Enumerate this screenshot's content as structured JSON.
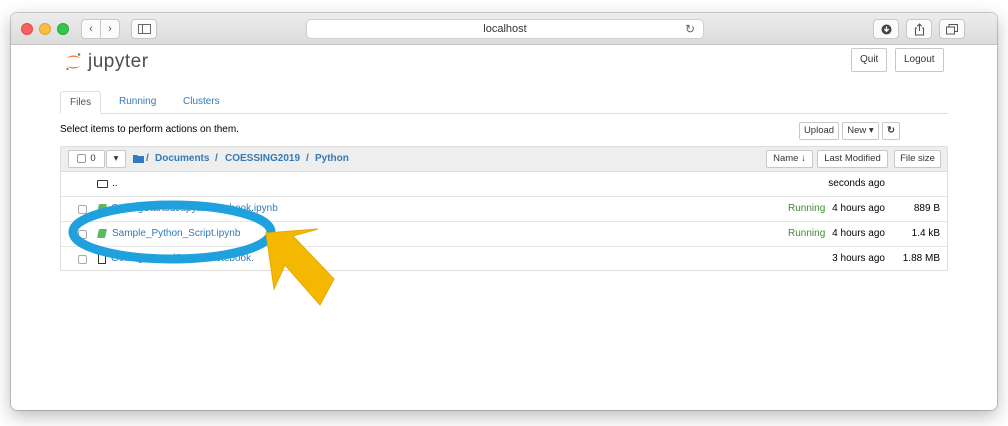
{
  "browser": {
    "url": "localhost",
    "nav_back": "‹",
    "nav_forward": "›"
  },
  "header": {
    "logo_text": "jupyter",
    "quit_label": "Quit",
    "logout_label": "Logout"
  },
  "tabs": [
    {
      "label": "Files",
      "active": true
    },
    {
      "label": "Running",
      "active": false
    },
    {
      "label": "Clusters",
      "active": false
    }
  ],
  "toolbar": {
    "hint": "Select items to perform actions on them.",
    "upload_label": "Upload",
    "new_label": "New ▾",
    "refresh_icon": "refresh-icon"
  },
  "list_header": {
    "selected_count": "0",
    "breadcrumb": [
      "Documents",
      "COESSING2019",
      "Python"
    ],
    "sort_name": "Name ↓",
    "sort_modified": "Last Modified",
    "sort_size": "File size"
  },
  "rows": [
    {
      "name": "..",
      "type": "folder",
      "status": "",
      "modified": "seconds ago",
      "size": ""
    },
    {
      "name": "GettingStartedJupyterNotebook.ipynb",
      "type": "notebook",
      "status": "Running",
      "modified": "4 hours ago",
      "size": "889 B"
    },
    {
      "name": "Sample_Python_Script.ipynb",
      "type": "notebook",
      "status": "Running",
      "modified": "4 hours ago",
      "size": "1.4 kB"
    },
    {
      "name": "GettingStartedJupyterNotebook.",
      "type": "file",
      "status": "",
      "modified": "3 hours ago",
      "size": "1.88 MB"
    }
  ],
  "annotation": {
    "highlight_color": "#1fa1dd",
    "arrow_color": "#f5b800"
  }
}
